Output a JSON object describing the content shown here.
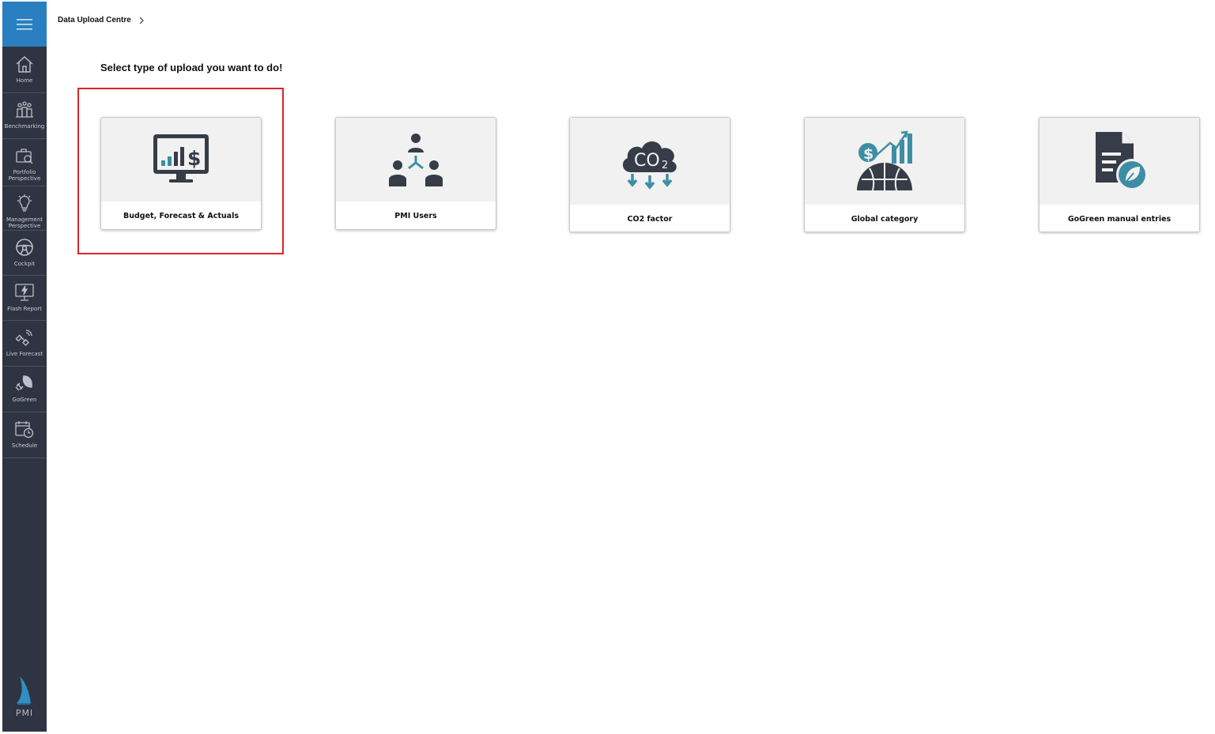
{
  "sidebar": {
    "menu_label": "",
    "items": [
      {
        "label": "Home",
        "icon": "home-icon"
      },
      {
        "label": "Benchmarking",
        "icon": "benchmarking-icon"
      },
      {
        "label": "Portfolio Perspective",
        "icon": "portfolio-icon"
      },
      {
        "label": "Management Perspective",
        "icon": "lightbulb-icon"
      },
      {
        "label": "Cockpit",
        "icon": "steering-wheel-icon"
      },
      {
        "label": "Flash Report",
        "icon": "flash-monitor-icon"
      },
      {
        "label": "Live Forecast",
        "icon": "satellite-icon"
      },
      {
        "label": "GoGreen",
        "icon": "plug-leaf-icon"
      },
      {
        "label": "Schedule",
        "icon": "calendar-clock-icon"
      }
    ],
    "logo_text": "PMI"
  },
  "breadcrumb": {
    "items": [
      "Data Upload Centre"
    ]
  },
  "main": {
    "title": "Select type of upload you want to do!",
    "cards": [
      {
        "label": "Budget, Forecast & Actuals",
        "icon": "monitor-chart-dollar-icon",
        "selected": true
      },
      {
        "label": "PMI Users",
        "icon": "users-network-icon",
        "selected": false
      },
      {
        "label": "CO2 factor",
        "icon": "co2-cloud-icon",
        "selected": false
      },
      {
        "label": "Global category",
        "icon": "globe-dollar-growth-icon",
        "selected": false
      },
      {
        "label": "GoGreen manual entries",
        "icon": "document-leaf-icon",
        "selected": false
      }
    ]
  },
  "colors": {
    "sidebar_bg": "#2e3441",
    "menu_bg": "#2a7fc1",
    "icon_dark": "#363c48",
    "icon_accent": "#3d8ea5",
    "highlight": "#d9262e"
  }
}
